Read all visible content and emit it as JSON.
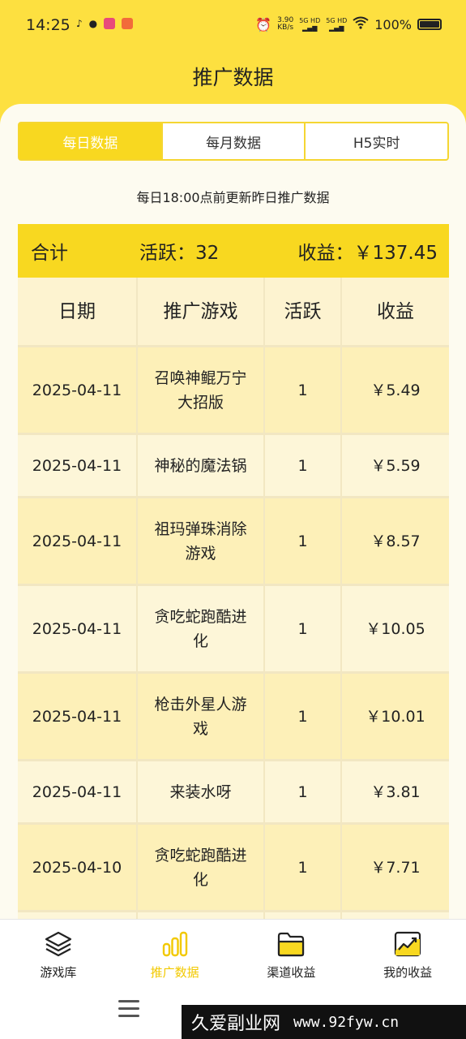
{
  "status_bar": {
    "time": "14:25",
    "speed_value": "3.90",
    "speed_unit": "KB/s",
    "signal1": "5G HD",
    "signal2": "5G HD",
    "battery": "100%"
  },
  "page_title": "推广数据",
  "tabs": [
    {
      "label": "每日数据",
      "active": true
    },
    {
      "label": "每月数据",
      "active": false
    },
    {
      "label": "H5实时",
      "active": false
    }
  ],
  "note": "每日18:00点前更新昨日推广数据",
  "summary": {
    "total_label": "合计",
    "active_text": "活跃：32",
    "earnings_text": "收益：￥137.45"
  },
  "table": {
    "headers": [
      "日期",
      "推广游戏",
      "活跃",
      "收益"
    ],
    "rows": [
      {
        "date": "2025-04-11",
        "game": "召唤神鲲万宁大招版",
        "active": "1",
        "earnings": "￥5.49"
      },
      {
        "date": "2025-04-11",
        "game": "神秘的魔法锅",
        "active": "1",
        "earnings": "￥5.59"
      },
      {
        "date": "2025-04-11",
        "game": "祖玛弹珠消除游戏",
        "active": "1",
        "earnings": "￥8.57"
      },
      {
        "date": "2025-04-11",
        "game": "贪吃蛇跑酷进化",
        "active": "1",
        "earnings": "￥10.05"
      },
      {
        "date": "2025-04-11",
        "game": "枪击外星人游戏",
        "active": "1",
        "earnings": "￥10.01"
      },
      {
        "date": "2025-04-11",
        "game": "来装水呀",
        "active": "1",
        "earnings": "￥3.81"
      },
      {
        "date": "2025-04-10",
        "game": "贪吃蛇跑酷进化",
        "active": "1",
        "earnings": "￥7.71"
      }
    ]
  },
  "bottom_nav": [
    {
      "label": "游戏库",
      "icon": "layers-icon",
      "active": false
    },
    {
      "label": "推广数据",
      "icon": "bar-chart-icon",
      "active": true
    },
    {
      "label": "渠道收益",
      "icon": "folder-icon",
      "active": false
    },
    {
      "label": "我的收益",
      "icon": "trend-chart-icon",
      "active": false
    }
  ],
  "watermark": {
    "text": "久爱副业网",
    "url": "www.92fyw.cn"
  },
  "colors": {
    "accent": "#f8d820",
    "background": "#fde040",
    "row_odd": "#fdf0b8",
    "row_even": "#fdf6d8"
  }
}
